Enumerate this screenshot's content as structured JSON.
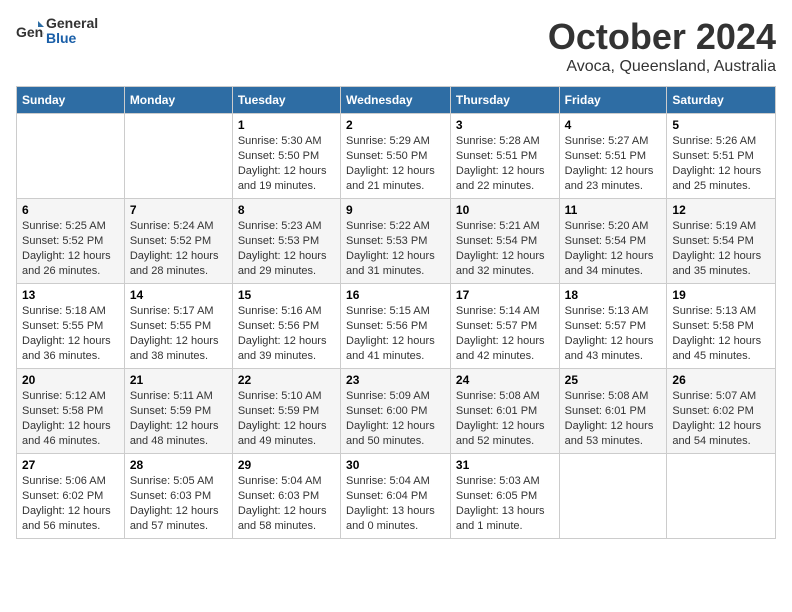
{
  "logo": {
    "general": "General",
    "blue": "Blue"
  },
  "title": "October 2024",
  "subtitle": "Avoca, Queensland, Australia",
  "headers": [
    "Sunday",
    "Monday",
    "Tuesday",
    "Wednesday",
    "Thursday",
    "Friday",
    "Saturday"
  ],
  "weeks": [
    [
      {
        "day": "",
        "info": ""
      },
      {
        "day": "",
        "info": ""
      },
      {
        "day": "1",
        "info": "Sunrise: 5:30 AM\nSunset: 5:50 PM\nDaylight: 12 hours and 19 minutes."
      },
      {
        "day": "2",
        "info": "Sunrise: 5:29 AM\nSunset: 5:50 PM\nDaylight: 12 hours and 21 minutes."
      },
      {
        "day": "3",
        "info": "Sunrise: 5:28 AM\nSunset: 5:51 PM\nDaylight: 12 hours and 22 minutes."
      },
      {
        "day": "4",
        "info": "Sunrise: 5:27 AM\nSunset: 5:51 PM\nDaylight: 12 hours and 23 minutes."
      },
      {
        "day": "5",
        "info": "Sunrise: 5:26 AM\nSunset: 5:51 PM\nDaylight: 12 hours and 25 minutes."
      }
    ],
    [
      {
        "day": "6",
        "info": "Sunrise: 5:25 AM\nSunset: 5:52 PM\nDaylight: 12 hours and 26 minutes."
      },
      {
        "day": "7",
        "info": "Sunrise: 5:24 AM\nSunset: 5:52 PM\nDaylight: 12 hours and 28 minutes."
      },
      {
        "day": "8",
        "info": "Sunrise: 5:23 AM\nSunset: 5:53 PM\nDaylight: 12 hours and 29 minutes."
      },
      {
        "day": "9",
        "info": "Sunrise: 5:22 AM\nSunset: 5:53 PM\nDaylight: 12 hours and 31 minutes."
      },
      {
        "day": "10",
        "info": "Sunrise: 5:21 AM\nSunset: 5:54 PM\nDaylight: 12 hours and 32 minutes."
      },
      {
        "day": "11",
        "info": "Sunrise: 5:20 AM\nSunset: 5:54 PM\nDaylight: 12 hours and 34 minutes."
      },
      {
        "day": "12",
        "info": "Sunrise: 5:19 AM\nSunset: 5:54 PM\nDaylight: 12 hours and 35 minutes."
      }
    ],
    [
      {
        "day": "13",
        "info": "Sunrise: 5:18 AM\nSunset: 5:55 PM\nDaylight: 12 hours and 36 minutes."
      },
      {
        "day": "14",
        "info": "Sunrise: 5:17 AM\nSunset: 5:55 PM\nDaylight: 12 hours and 38 minutes."
      },
      {
        "day": "15",
        "info": "Sunrise: 5:16 AM\nSunset: 5:56 PM\nDaylight: 12 hours and 39 minutes."
      },
      {
        "day": "16",
        "info": "Sunrise: 5:15 AM\nSunset: 5:56 PM\nDaylight: 12 hours and 41 minutes."
      },
      {
        "day": "17",
        "info": "Sunrise: 5:14 AM\nSunset: 5:57 PM\nDaylight: 12 hours and 42 minutes."
      },
      {
        "day": "18",
        "info": "Sunrise: 5:13 AM\nSunset: 5:57 PM\nDaylight: 12 hours and 43 minutes."
      },
      {
        "day": "19",
        "info": "Sunrise: 5:13 AM\nSunset: 5:58 PM\nDaylight: 12 hours and 45 minutes."
      }
    ],
    [
      {
        "day": "20",
        "info": "Sunrise: 5:12 AM\nSunset: 5:58 PM\nDaylight: 12 hours and 46 minutes."
      },
      {
        "day": "21",
        "info": "Sunrise: 5:11 AM\nSunset: 5:59 PM\nDaylight: 12 hours and 48 minutes."
      },
      {
        "day": "22",
        "info": "Sunrise: 5:10 AM\nSunset: 5:59 PM\nDaylight: 12 hours and 49 minutes."
      },
      {
        "day": "23",
        "info": "Sunrise: 5:09 AM\nSunset: 6:00 PM\nDaylight: 12 hours and 50 minutes."
      },
      {
        "day": "24",
        "info": "Sunrise: 5:08 AM\nSunset: 6:01 PM\nDaylight: 12 hours and 52 minutes."
      },
      {
        "day": "25",
        "info": "Sunrise: 5:08 AM\nSunset: 6:01 PM\nDaylight: 12 hours and 53 minutes."
      },
      {
        "day": "26",
        "info": "Sunrise: 5:07 AM\nSunset: 6:02 PM\nDaylight: 12 hours and 54 minutes."
      }
    ],
    [
      {
        "day": "27",
        "info": "Sunrise: 5:06 AM\nSunset: 6:02 PM\nDaylight: 12 hours and 56 minutes."
      },
      {
        "day": "28",
        "info": "Sunrise: 5:05 AM\nSunset: 6:03 PM\nDaylight: 12 hours and 57 minutes."
      },
      {
        "day": "29",
        "info": "Sunrise: 5:04 AM\nSunset: 6:03 PM\nDaylight: 12 hours and 58 minutes."
      },
      {
        "day": "30",
        "info": "Sunrise: 5:04 AM\nSunset: 6:04 PM\nDaylight: 13 hours and 0 minutes."
      },
      {
        "day": "31",
        "info": "Sunrise: 5:03 AM\nSunset: 6:05 PM\nDaylight: 13 hours and 1 minute."
      },
      {
        "day": "",
        "info": ""
      },
      {
        "day": "",
        "info": ""
      }
    ]
  ]
}
